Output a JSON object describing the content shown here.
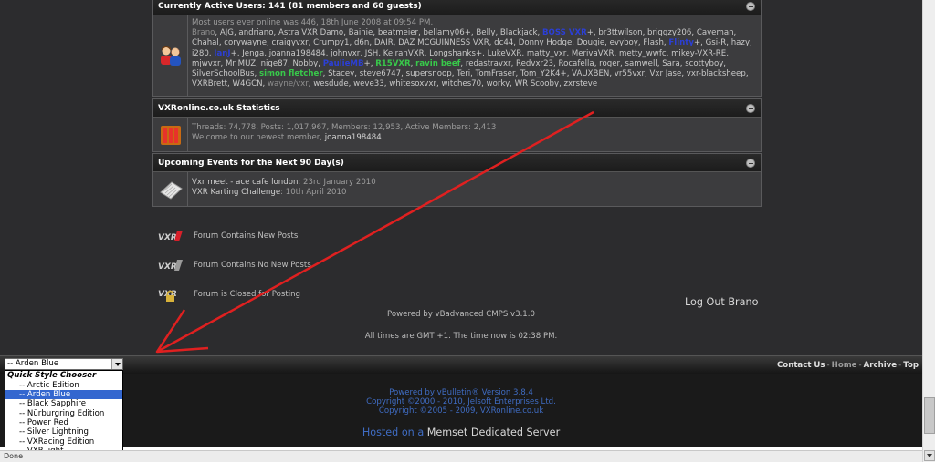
{
  "who_online": {
    "title": "Currently Active Users: 141 (81 members and 60 guests)",
    "most_ever": "Most users ever online was 446, 18th June 2008 at 09:54 PM.",
    "users": [
      {
        "n": "Brano",
        "c": "grey"
      },
      {
        "n": "AJG",
        "c": ""
      },
      {
        "n": "andriano",
        "c": ""
      },
      {
        "n": "Astra VXR Damo",
        "c": ""
      },
      {
        "n": "Bainie",
        "c": ""
      },
      {
        "n": "beatmeier",
        "c": ""
      },
      {
        "n": "bellamy06+",
        "c": ""
      },
      {
        "n": "Belly",
        "c": ""
      },
      {
        "n": "Blackjack",
        "c": ""
      },
      {
        "n": "BOSS VXR",
        "c": "blue",
        "suffix": "+"
      },
      {
        "n": "br3ttwilson",
        "c": ""
      },
      {
        "n": "briggzy206",
        "c": ""
      },
      {
        "n": "Caveman",
        "c": ""
      },
      {
        "n": "Chahal",
        "c": ""
      },
      {
        "n": "corywayne",
        "c": ""
      },
      {
        "n": "craigyvxr",
        "c": ""
      },
      {
        "n": "Crumpy1",
        "c": ""
      },
      {
        "n": "d6n",
        "c": ""
      },
      {
        "n": "DAIR",
        "c": ""
      },
      {
        "n": "DAZ MCGUINNESS VXR",
        "c": ""
      },
      {
        "n": "dc44",
        "c": ""
      },
      {
        "n": "Donny Hodge",
        "c": ""
      },
      {
        "n": "Dougie",
        "c": ""
      },
      {
        "n": "evyboy",
        "c": ""
      },
      {
        "n": "Flash",
        "c": ""
      },
      {
        "n": "Flinty",
        "c": "blue",
        "suffix": "+"
      },
      {
        "n": "Gsi-R",
        "c": ""
      },
      {
        "n": "hazy",
        "c": ""
      },
      {
        "n": "i280",
        "c": ""
      },
      {
        "n": "IanJ",
        "c": "blue",
        "suffix": "+"
      },
      {
        "n": "Jenga",
        "c": ""
      },
      {
        "n": "joanna198484",
        "c": ""
      },
      {
        "n": "johnvxr",
        "c": ""
      },
      {
        "n": "JSH",
        "c": ""
      },
      {
        "n": "KeiranVXR",
        "c": ""
      },
      {
        "n": "Longshanks+",
        "c": ""
      },
      {
        "n": "LukeVXR",
        "c": ""
      },
      {
        "n": "matty_vxr",
        "c": ""
      },
      {
        "n": "MerivaVXR",
        "c": ""
      },
      {
        "n": "metty_wwfc",
        "c": ""
      },
      {
        "n": "mikey-VXR-RE",
        "c": ""
      },
      {
        "n": "mjwvxr",
        "c": ""
      },
      {
        "n": "Mr MUZ",
        "c": ""
      },
      {
        "n": "nige87",
        "c": ""
      },
      {
        "n": "Nobby",
        "c": ""
      },
      {
        "n": "PaulieMB",
        "c": "blue",
        "suffix": "+"
      },
      {
        "n": "R15VXR",
        "c": "green"
      },
      {
        "n": "ravin beef",
        "c": "green"
      },
      {
        "n": "redastravxr",
        "c": ""
      },
      {
        "n": "Redvxr23",
        "c": ""
      },
      {
        "n": "Rocafella",
        "c": ""
      },
      {
        "n": "roger",
        "c": ""
      },
      {
        "n": "samwell",
        "c": ""
      },
      {
        "n": "Sara",
        "c": ""
      },
      {
        "n": "scottyboy",
        "c": ""
      },
      {
        "n": "SilverSchoolBus",
        "c": ""
      },
      {
        "n": "simon fletcher",
        "c": "green"
      },
      {
        "n": "Stacey",
        "c": ""
      },
      {
        "n": "steve6747",
        "c": ""
      },
      {
        "n": "supersnoop",
        "c": ""
      },
      {
        "n": "Teri",
        "c": ""
      },
      {
        "n": "TomFraser",
        "c": ""
      },
      {
        "n": "Tom_Y2K4+",
        "c": ""
      },
      {
        "n": "VAUXBEN",
        "c": ""
      },
      {
        "n": "vr55vxr",
        "c": ""
      },
      {
        "n": "Vxr Jase",
        "c": ""
      },
      {
        "n": "vxr-blacksheep",
        "c": ""
      },
      {
        "n": "VXRBrett",
        "c": ""
      },
      {
        "n": "W4GCN",
        "c": ""
      },
      {
        "n": "wayne/vxr",
        "c": "grey"
      },
      {
        "n": "wesdude",
        "c": ""
      },
      {
        "n": "weve33",
        "c": ""
      },
      {
        "n": "whitesoxvxr",
        "c": ""
      },
      {
        "n": "witches70",
        "c": ""
      },
      {
        "n": "worky",
        "c": ""
      },
      {
        "n": "WR Scooby",
        "c": ""
      },
      {
        "n": "zxrsteve",
        "c": ""
      }
    ]
  },
  "stats": {
    "title": "VXRonline.co.uk Statistics",
    "line1": "Threads: 74,778, Posts: 1,017,967, Members: 12,953, Active Members: 2,413",
    "welcome_prefix": "Welcome to our newest member, ",
    "newest_member": "joanna198484"
  },
  "events": {
    "title": "Upcoming Events for the Next 90 Day(s)",
    "items": [
      {
        "name": "Vxr meet - ace cafe london",
        "date": ": 23rd January 2010"
      },
      {
        "name": "VXR Karting Challenge",
        "date": ": 10th April 2010"
      }
    ]
  },
  "legend": {
    "new_posts": "Forum Contains New Posts",
    "no_new_posts": "Forum Contains No New Posts",
    "closed": "Forum is Closed for Posting"
  },
  "logout": "Log Out Brano",
  "powered_vba": "Powered by vBadvanced CMPS v3.1.0",
  "time_note": "All times are GMT +1. The time now is 02:38 PM.",
  "footer_links": {
    "contact": "Contact Us",
    "home": "Home",
    "archive": "Archive",
    "top": "Top"
  },
  "copyright": {
    "line1": "Powered by vBulletin® Version 3.8.4",
    "line2": "Copyright ©2000 - 2010, Jelsoft Enterprises Ltd.",
    "line3": "Copyright ©2005 - 2009, VXRonline.co.uk"
  },
  "hosted": {
    "prefix": "Hosted on a ",
    "name": "Memset Dedicated Server"
  },
  "style_chooser": {
    "selected": "-- Arden Blue",
    "group": "Quick Style Chooser",
    "options": [
      {
        "label": "-- Arctic Edition"
      },
      {
        "label": "-- Arden Blue",
        "selected": true
      },
      {
        "label": "-- Black Sapphire"
      },
      {
        "label": "-- Nürburgring Edition"
      },
      {
        "label": "-- Power Red"
      },
      {
        "label": "-- Silver Lightning"
      },
      {
        "label": "-- VXRacing Edition"
      },
      {
        "label": "-- VXR light"
      }
    ]
  },
  "status_bar": "Done",
  "colors": {
    "page_bg": "#2c2c2e",
    "user_blue": "#2b3fd6",
    "user_green": "#38c94a",
    "link_blue": "#3f6cc3",
    "arrow_red": "#e02020",
    "select_blue": "#3467cf"
  }
}
